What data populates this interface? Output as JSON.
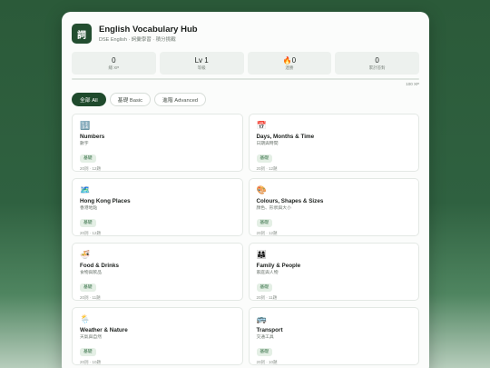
{
  "app": {
    "logo_char": "詞",
    "title": "English Vocabulary Hub",
    "subtitle": "DSE English · 詞彙學習 · 積分挑戰"
  },
  "stats": [
    {
      "value": "0",
      "label": "總 XP"
    },
    {
      "value": "Lv 1",
      "label": "等級"
    },
    {
      "value": "🔥0",
      "label": "連勝"
    },
    {
      "value": "0",
      "label": "累計答對"
    }
  ],
  "xp": {
    "progress": 0,
    "label": "100 XP"
  },
  "filters": [
    {
      "label": "全部 All",
      "active": true
    },
    {
      "label": "基礎 Basic",
      "active": false
    },
    {
      "label": "進階 Advanced",
      "active": false
    }
  ],
  "topics": [
    {
      "icon": "🔢",
      "icon_name": "numbers-icon",
      "name": "Numbers",
      "name_zh": "數字",
      "badge": "基礎",
      "meta": "20詞 · 12題"
    },
    {
      "icon": "📅",
      "icon_name": "calendar-icon",
      "name": "Days, Months & Time",
      "name_zh": "日期與時間",
      "badge": "基礎",
      "meta": "20詞 · 12題"
    },
    {
      "icon": "🗺️",
      "icon_name": "map-icon",
      "name": "Hong Kong Places",
      "name_zh": "香港地點",
      "badge": "基礎",
      "meta": "20詞 · 12題"
    },
    {
      "icon": "🎨",
      "icon_name": "palette-icon",
      "name": "Colours, Shapes & Sizes",
      "name_zh": "顏色、形狀與大小",
      "badge": "基礎",
      "meta": "20詞 · 12題"
    },
    {
      "icon": "🍜",
      "icon_name": "noodle-bowl-icon",
      "name": "Food & Drinks",
      "name_zh": "食物與飲品",
      "badge": "基礎",
      "meta": "20詞 · 11題"
    },
    {
      "icon": "👨‍👩‍👧",
      "icon_name": "family-icon",
      "name": "Family & People",
      "name_zh": "家庭與人物",
      "badge": "基礎",
      "meta": "20詞 · 11題"
    },
    {
      "icon": "🌦️",
      "icon_name": "weather-icon",
      "name": "Weather & Nature",
      "name_zh": "天氣與自然",
      "badge": "基礎",
      "meta": "20詞 · 10題"
    },
    {
      "icon": "🚌",
      "icon_name": "bus-icon",
      "name": "Transport",
      "name_zh": "交通工具",
      "badge": "基礎",
      "meta": "20詞 · 10題"
    }
  ]
}
